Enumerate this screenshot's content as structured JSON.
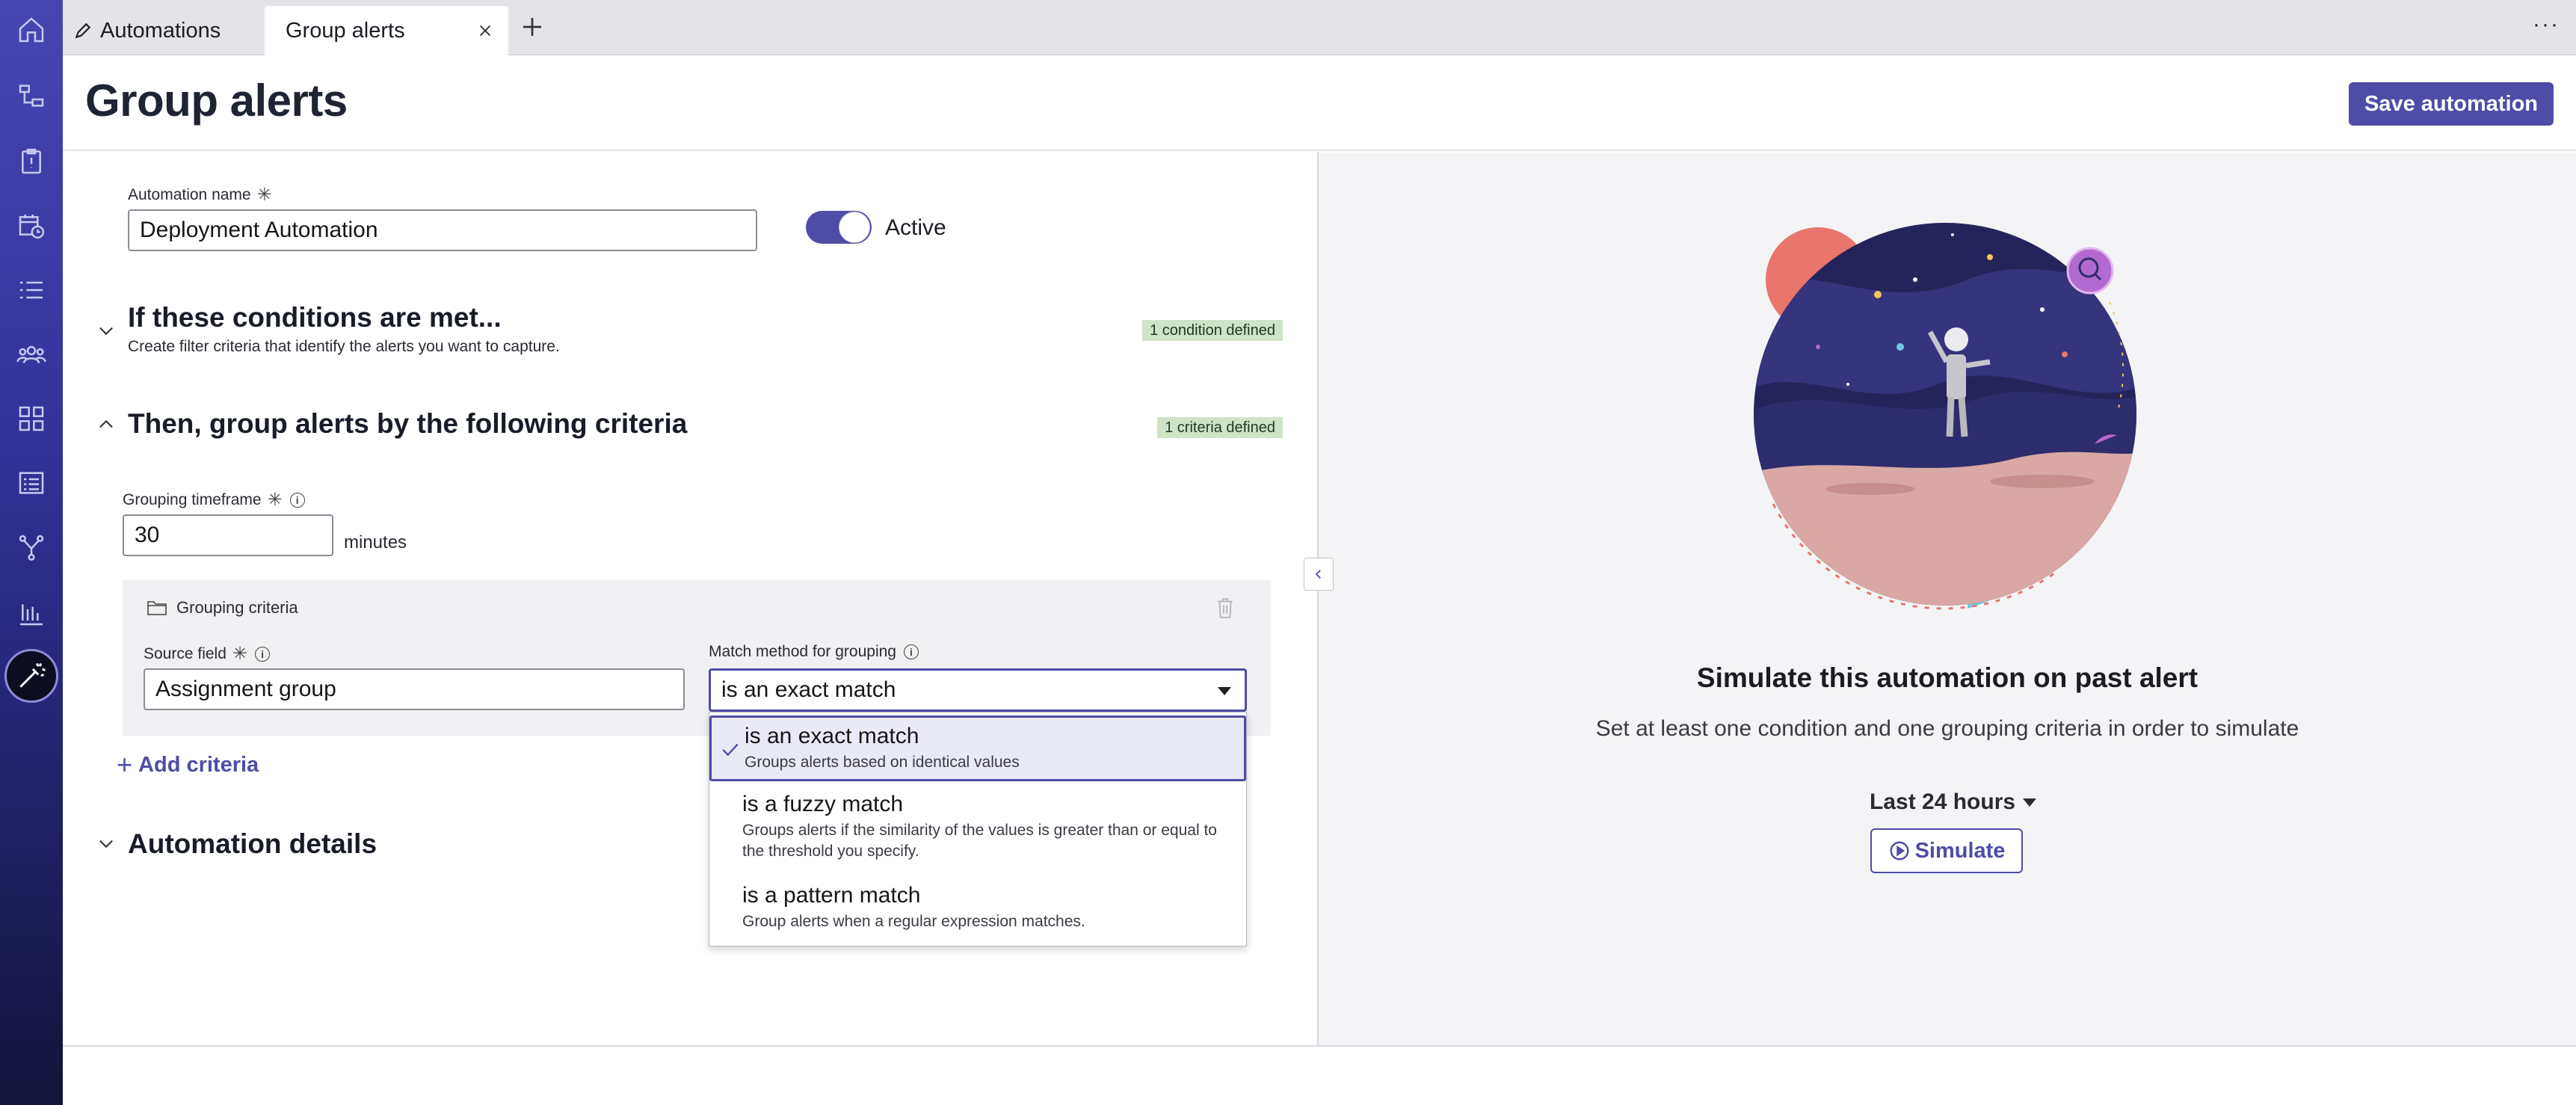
{
  "tabs": {
    "automations": "Automations",
    "group_alerts": "Group alerts",
    "more": "···"
  },
  "header": {
    "title": "Group alerts",
    "save_label": "Save automation"
  },
  "form": {
    "name_label": "Automation name",
    "name_value": "Deployment Automation",
    "active_label": "Active",
    "active": true
  },
  "conditions": {
    "title": "If these conditions are met...",
    "subtitle": "Create filter criteria that identify the alerts you want to capture.",
    "badge": "1 condition defined"
  },
  "grouping": {
    "title": "Then, group alerts by the following criteria",
    "badge": "1 criteria defined",
    "timeframe_label": "Grouping timeframe",
    "timeframe_value": "30",
    "timeframe_unit": "minutes",
    "criteria_header": "Grouping criteria",
    "source_label": "Source field",
    "source_value": "Assignment group",
    "match_label": "Match method for grouping",
    "match_value": "is an exact match",
    "add_criteria": "Add criteria",
    "options": [
      {
        "label": "is an exact match",
        "desc": "Groups alerts based on identical values",
        "selected": true
      },
      {
        "label": "is a fuzzy match",
        "desc": "Groups alerts if the similarity of the values is greater than or equal to the threshold you specify.",
        "selected": false
      },
      {
        "label": "is a pattern match",
        "desc": "Group alerts when a regular expression matches.",
        "selected": false
      }
    ]
  },
  "details": {
    "title": "Automation details"
  },
  "simulate": {
    "title": "Simulate this automation on past alert",
    "subtitle": "Set at least one condition and one grouping criteria in order to simulate",
    "range": "Last 24 hours",
    "button": "Simulate"
  },
  "colors": {
    "accent": "#4f4ca8",
    "badge_bg": "#cfe3c6"
  },
  "icons": {
    "rail": [
      "home-icon",
      "hierarchy-icon",
      "clipboard-icon",
      "calendar-clock-icon",
      "list-icon",
      "team-icon",
      "grid-icon",
      "form-list-icon",
      "branch-icon",
      "bar-chart-icon",
      "magic-wand-icon"
    ]
  }
}
